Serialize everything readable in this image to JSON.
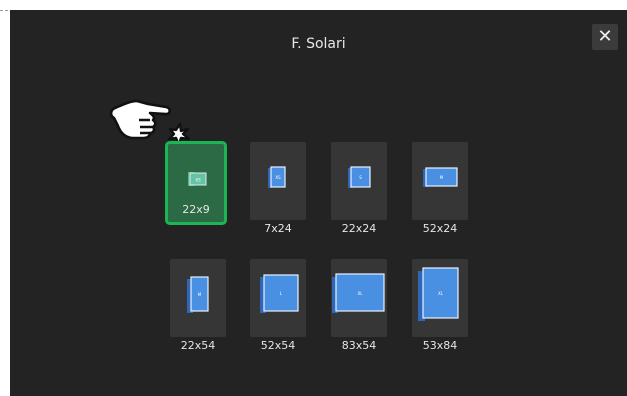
{
  "dialog": {
    "title": "F. Solari",
    "close_label": "✕"
  },
  "sizes": [
    {
      "label": "22x9",
      "book_text": "XS",
      "selected": true
    },
    {
      "label": "7x24",
      "book_text": "XS",
      "selected": false
    },
    {
      "label": "22x24",
      "book_text": "S",
      "selected": false
    },
    {
      "label": "52x24",
      "book_text": "M",
      "selected": false
    },
    {
      "label": "22x54",
      "book_text": "M",
      "selected": false
    },
    {
      "label": "52x54",
      "book_text": "L",
      "selected": false
    },
    {
      "label": "83x54",
      "book_text": "XL",
      "selected": false
    },
    {
      "label": "53x84",
      "book_text": "XL",
      "selected": false
    }
  ],
  "colors": {
    "background": "#232323",
    "tile": "#363636",
    "selected_border": "#1cb556",
    "book_blue": "#4a90e2"
  },
  "icons": {
    "pointer": "pointing-hand-icon",
    "close": "close-icon"
  }
}
